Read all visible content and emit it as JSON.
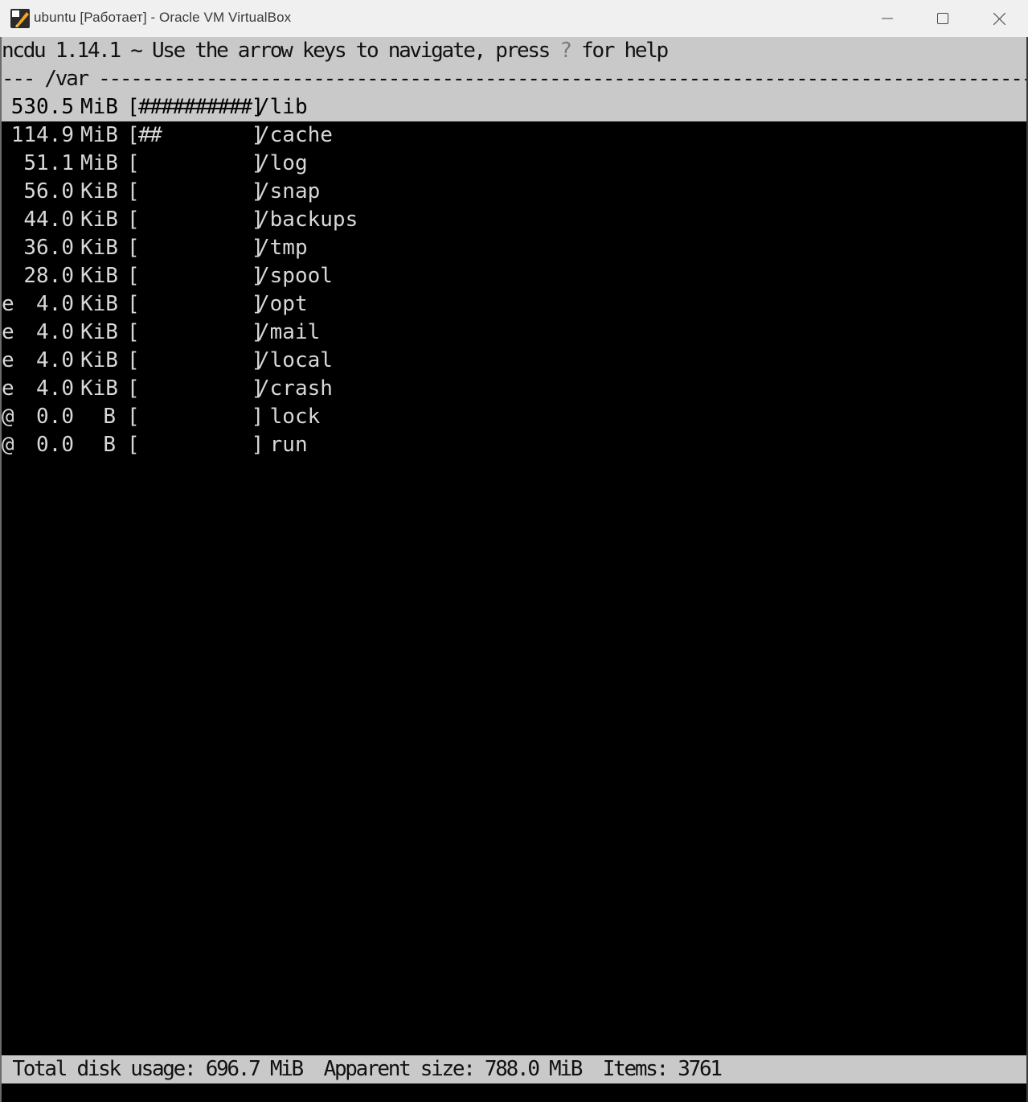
{
  "window": {
    "title": "ubuntu [Работает] - Oracle VM VirtualBox",
    "app_icon": "virtualbox-icon",
    "controls": [
      "minimize-icon",
      "maximize-icon",
      "close-icon"
    ]
  },
  "terminal": {
    "header": {
      "prefix": "ncdu 1.14.1 ~ Use the arrow keys to navigate, press ",
      "help_key": "?",
      "suffix": " for help"
    },
    "path_line": "--- /var -----------------------------------------------------------------------------------------------------",
    "entries": [
      {
        "flag": " ",
        "size": "530.5",
        "unit": "MiB",
        "bar": "##########",
        "name": "/lib",
        "selected": true
      },
      {
        "flag": " ",
        "size": "114.9",
        "unit": "MiB",
        "bar": "##        ",
        "name": "/cache",
        "selected": false
      },
      {
        "flag": " ",
        "size": "51.1",
        "unit": "MiB",
        "bar": "          ",
        "name": "/log",
        "selected": false
      },
      {
        "flag": " ",
        "size": "56.0",
        "unit": "KiB",
        "bar": "          ",
        "name": "/snap",
        "selected": false
      },
      {
        "flag": " ",
        "size": "44.0",
        "unit": "KiB",
        "bar": "          ",
        "name": "/backups",
        "selected": false
      },
      {
        "flag": " ",
        "size": "36.0",
        "unit": "KiB",
        "bar": "          ",
        "name": "/tmp",
        "selected": false
      },
      {
        "flag": " ",
        "size": "28.0",
        "unit": "KiB",
        "bar": "          ",
        "name": "/spool",
        "selected": false
      },
      {
        "flag": "e",
        "size": "4.0",
        "unit": "KiB",
        "bar": "          ",
        "name": "/opt",
        "selected": false
      },
      {
        "flag": "e",
        "size": "4.0",
        "unit": "KiB",
        "bar": "          ",
        "name": "/mail",
        "selected": false
      },
      {
        "flag": "e",
        "size": "4.0",
        "unit": "KiB",
        "bar": "          ",
        "name": "/local",
        "selected": false
      },
      {
        "flag": "e",
        "size": "4.0",
        "unit": "KiB",
        "bar": "          ",
        "name": "/crash",
        "selected": false
      },
      {
        "flag": "@",
        "size": "0.0",
        "unit": "B",
        "bar": "          ",
        "name": " lock",
        "selected": false
      },
      {
        "flag": "@",
        "size": "0.0",
        "unit": "B",
        "bar": "          ",
        "name": " run",
        "selected": false
      }
    ],
    "status": " Total disk usage: 696.7 MiB  Apparent size: 788.0 MiB  Items: 3761"
  },
  "colors": {
    "terminal_bg": "#000000",
    "terminal_fg": "#d8d8d8",
    "inverse_bg": "#c9c9c9",
    "titlebar_bg": "#f0f0f0"
  }
}
